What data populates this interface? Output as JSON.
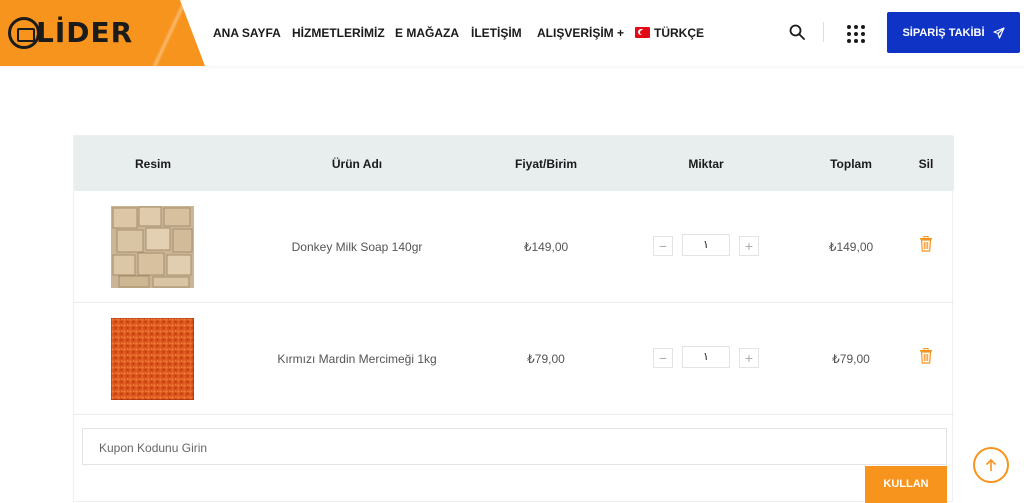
{
  "brand": {
    "name": "LİDER",
    "accent": "#f7941d",
    "primary": "#0f34c5"
  },
  "nav": {
    "items": [
      "ANA SAYFA",
      "HİZMETLERİMİZ",
      "E MAĞAZA",
      "İLETİŞİM",
      "ALIŞVERİŞİM +"
    ],
    "language": "TÜRKÇE",
    "track_order": "SİPARİŞ TAKİBİ"
  },
  "cart": {
    "headers": {
      "image": "Resim",
      "name": "Ürün Adı",
      "price": "Fiyat/Birim",
      "qty": "Miktar",
      "total": "Toplam",
      "remove": "Sil"
    },
    "items": [
      {
        "name": "Donkey Milk Soap 140gr",
        "price": "₺149,00",
        "qty": "١",
        "total": "₺149,00",
        "image": "soap-bars"
      },
      {
        "name": "Kırmızı Mardin Mercimeği 1kg",
        "price": "₺79,00",
        "qty": "١",
        "total": "₺79,00",
        "image": "red-lentils"
      }
    ],
    "coupon_placeholder": "Kupon Kodunu Girin",
    "apply_label": "KULLAN"
  }
}
